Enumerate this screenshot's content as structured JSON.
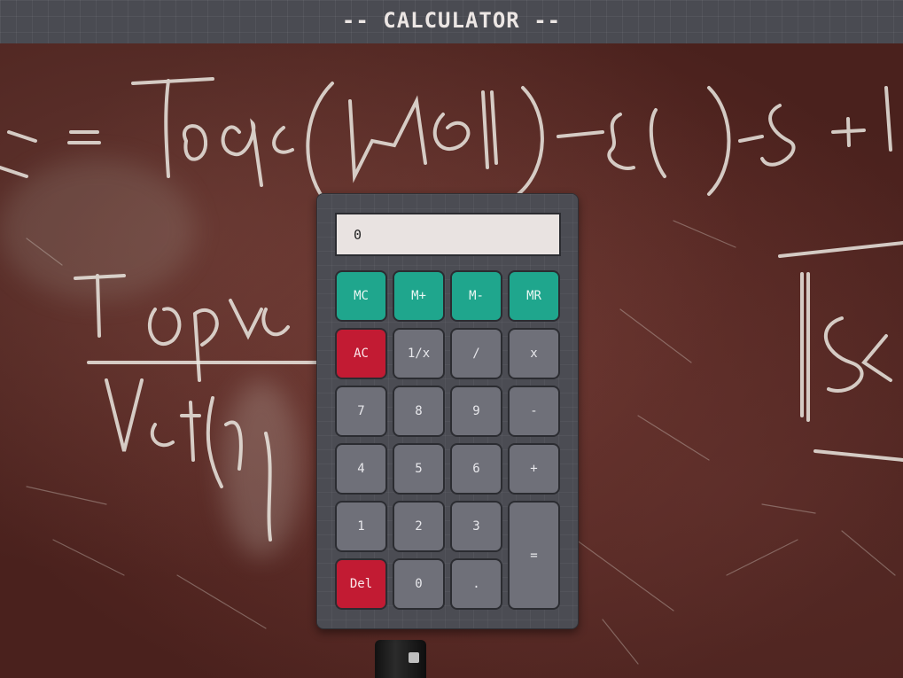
{
  "header": {
    "title": "-- CALCULATOR --"
  },
  "calculator": {
    "display_value": "0",
    "colors": {
      "memory_key": "#1fa68d",
      "danger_key": "#c21b33",
      "standard_key": "#6f7079",
      "display_bg": "#e9e3e1",
      "body": "#4b4c53"
    },
    "keys": {
      "mc": "MC",
      "m_plus": "M+",
      "m_minus": "M-",
      "mr": "MR",
      "ac": "AC",
      "reciprocal": "1/x",
      "divide": "/",
      "multiply": "x",
      "seven": "7",
      "eight": "8",
      "nine": "9",
      "minus": "-",
      "four": "4",
      "five": "5",
      "six": "6",
      "plus": "+",
      "one": "1",
      "two": "2",
      "three": "3",
      "equals": "=",
      "del": "Del",
      "zero": "0",
      "decimal": "."
    }
  },
  "background": {
    "type": "chalkboard-photo"
  }
}
